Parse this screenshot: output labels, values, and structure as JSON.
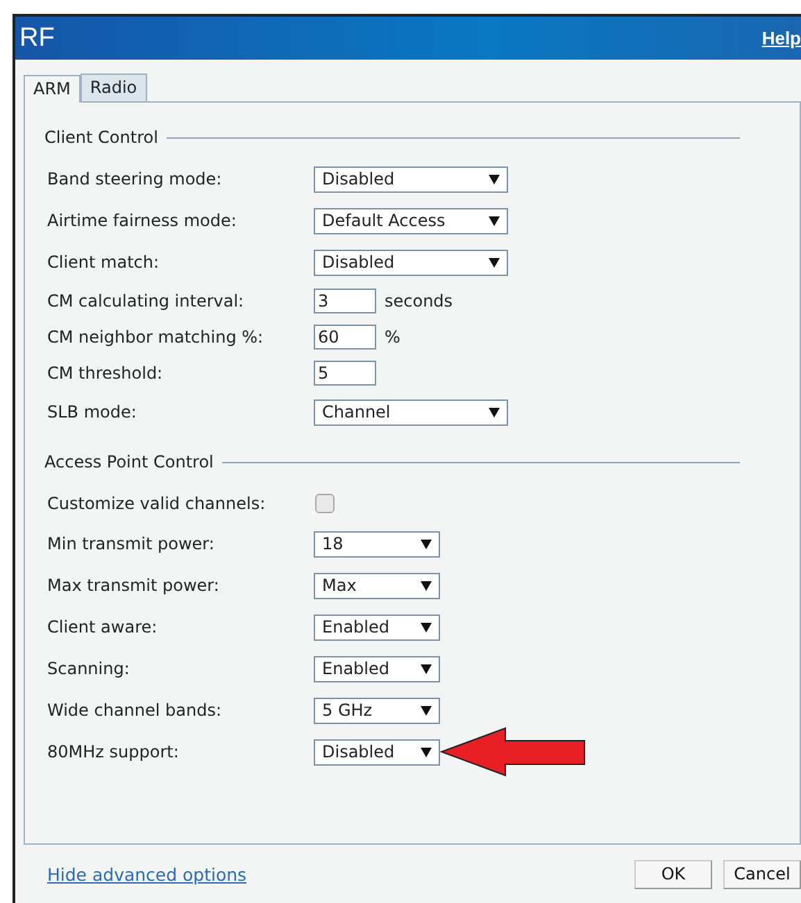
{
  "window": {
    "title": "RF",
    "help_link": "Help"
  },
  "tabs": [
    {
      "label": "ARM",
      "selected": true
    },
    {
      "label": "Radio",
      "selected": false
    }
  ],
  "sections": [
    {
      "title": "Client Control",
      "fields": [
        {
          "kind": "select",
          "label": "Band steering mode:",
          "value": "Disabled"
        },
        {
          "kind": "select",
          "label": "Airtime fairness mode:",
          "value": "Default Access"
        },
        {
          "kind": "select",
          "label": "Client match:",
          "value": "Disabled"
        },
        {
          "kind": "text",
          "label": "CM calculating interval:",
          "value": "3",
          "unit": "seconds"
        },
        {
          "kind": "text",
          "label": "CM neighbor matching %:",
          "value": "60",
          "unit": "%"
        },
        {
          "kind": "text",
          "label": "CM threshold:",
          "value": "5"
        },
        {
          "kind": "select",
          "label": "SLB mode:",
          "value": "Channel"
        }
      ]
    },
    {
      "title": "Access Point Control",
      "fields": [
        {
          "kind": "checkbox",
          "label": "Customize valid channels:",
          "checked": false
        },
        {
          "kind": "select",
          "label": "Min transmit power:",
          "value": "18"
        },
        {
          "kind": "select",
          "label": "Max transmit power:",
          "value": "Max"
        },
        {
          "kind": "select",
          "label": "Client aware:",
          "value": "Enabled"
        },
        {
          "kind": "select",
          "label": "Scanning:",
          "value": "Enabled"
        },
        {
          "kind": "select",
          "label": "Wide channel bands:",
          "value": "5 GHz"
        },
        {
          "kind": "select",
          "label": "80MHz support:",
          "value": "Disabled",
          "highlighted": true
        }
      ]
    }
  ],
  "footer": {
    "link": "Hide advanced options",
    "buttons": [
      "OK",
      "Cancel"
    ]
  }
}
